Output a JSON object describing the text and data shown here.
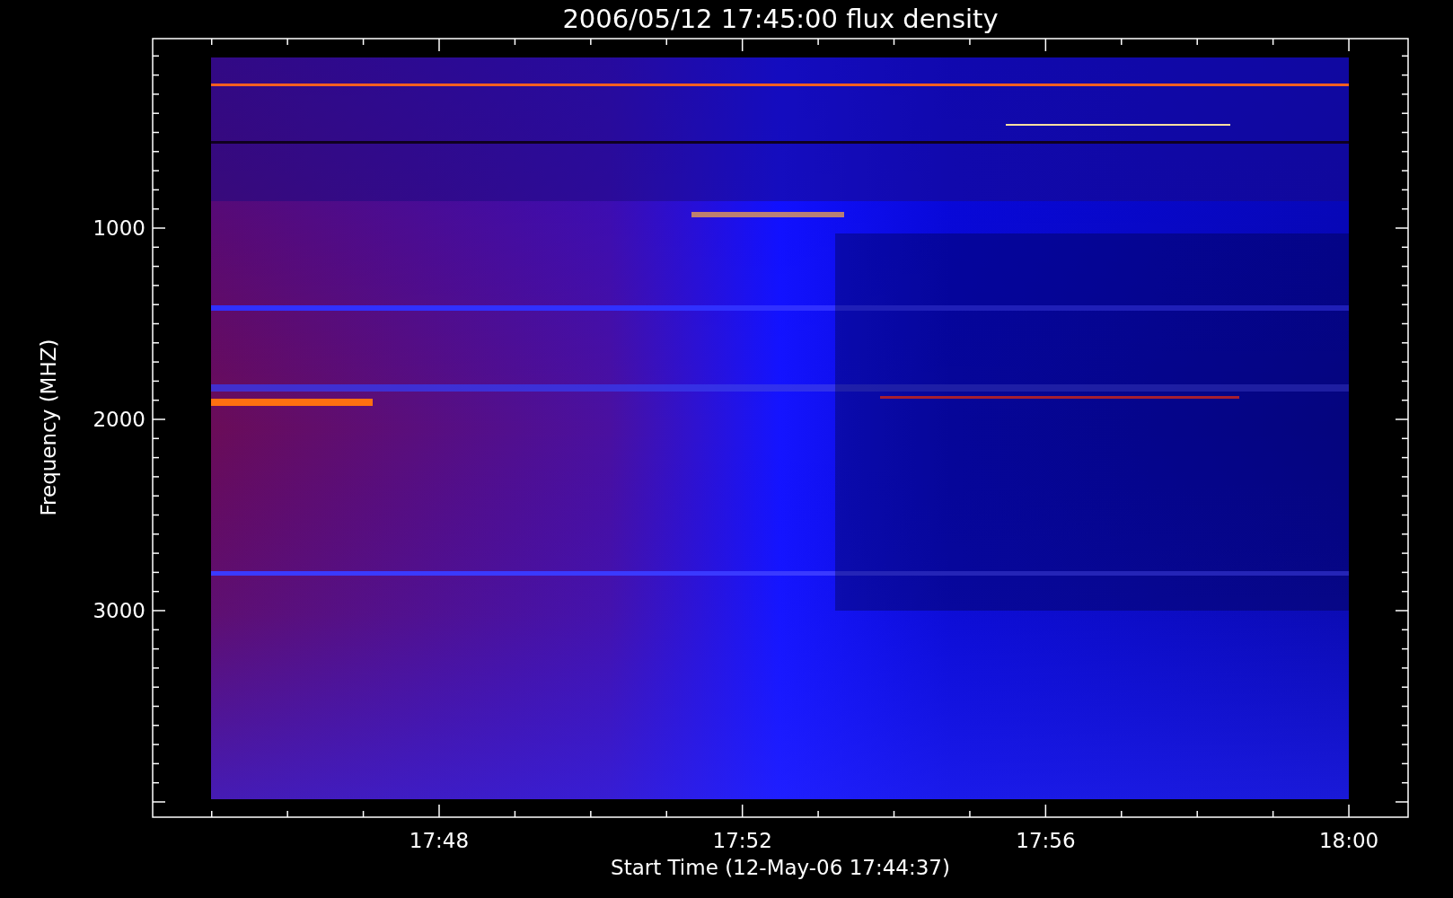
{
  "title": "2006/05/12 17:45:00 flux density",
  "y_axis": {
    "label": "Frequency (MHZ)",
    "tick_labels": [
      "1000",
      "2000",
      "3000"
    ]
  },
  "x_axis": {
    "label": "Start Time (12-May-06 17:44:37)",
    "tick_labels": [
      "17:48",
      "17:52",
      "17:56",
      "18:00"
    ]
  }
}
